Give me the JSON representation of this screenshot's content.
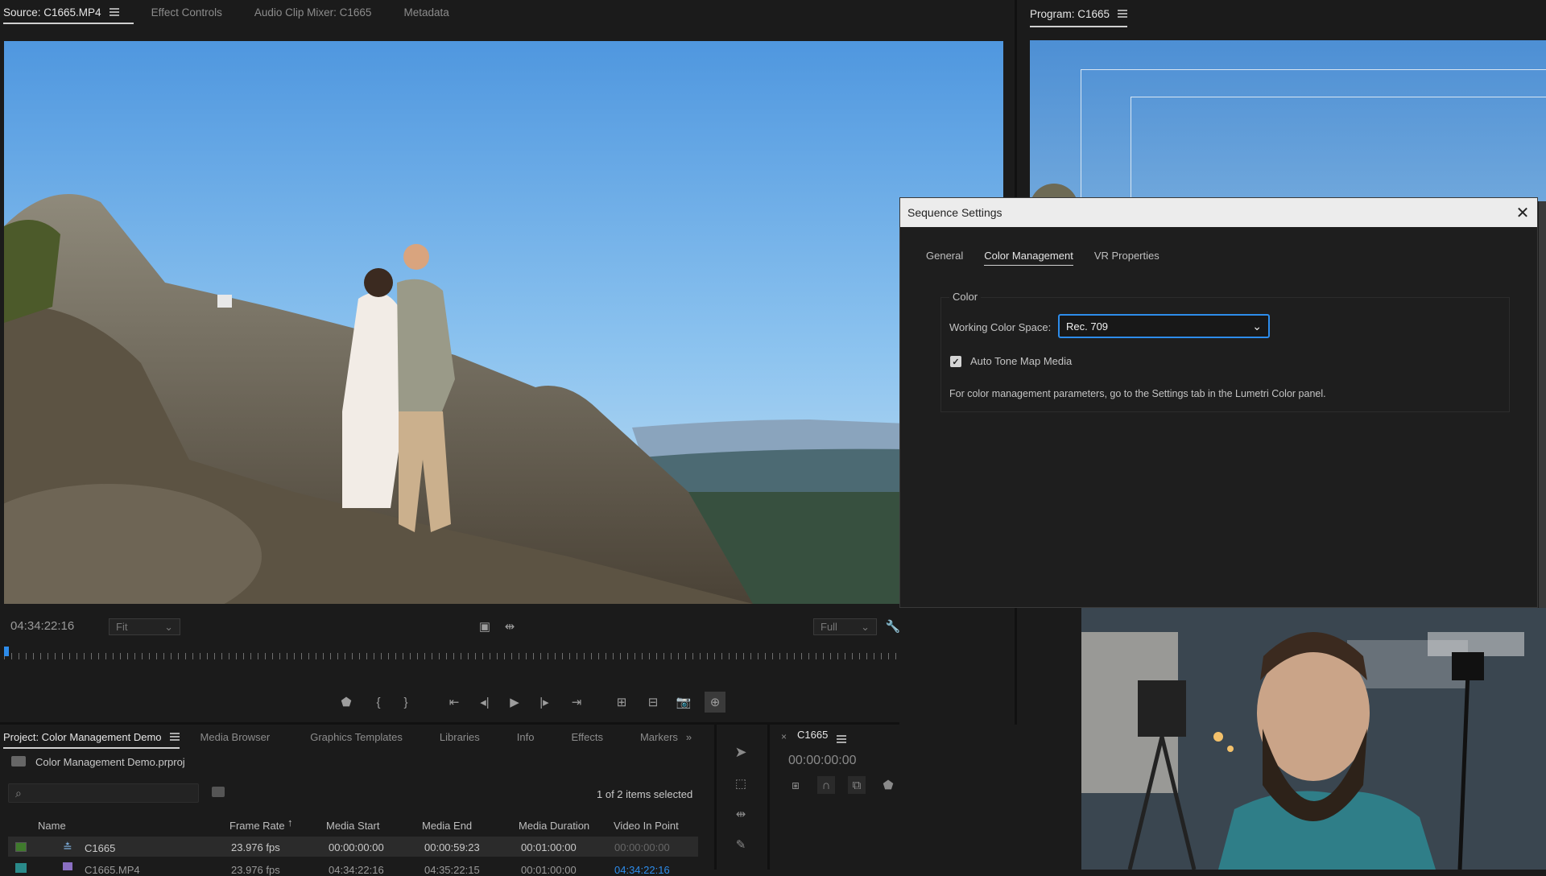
{
  "source_panel": {
    "tabs": [
      {
        "label": "Source: C1665.MP4"
      },
      {
        "label": "Effect Controls"
      },
      {
        "label": "Audio Clip Mixer: C1665"
      },
      {
        "label": "Metadata"
      }
    ],
    "timecode": "04:34:22:16",
    "zoom": "Fit",
    "resolution": "Full"
  },
  "program_panel": {
    "title": "Program: C1665"
  },
  "dialog": {
    "title": "Sequence Settings",
    "tabs": [
      {
        "label": "General"
      },
      {
        "label": "Color Management"
      },
      {
        "label": "VR Properties"
      }
    ],
    "group_label": "Color",
    "working_color_space_label": "Working Color Space:",
    "working_color_space_value": "Rec. 709",
    "auto_tone_map_label": "Auto Tone Map Media",
    "auto_tone_map_checked": true,
    "info_text": "For color management parameters, go to the Settings tab in the Lumetri Color panel."
  },
  "project_panel": {
    "tabs": [
      {
        "label": "Project: Color Management Demo"
      },
      {
        "label": "Media Browser"
      },
      {
        "label": "Graphics Templates"
      },
      {
        "label": "Libraries"
      },
      {
        "label": "Info"
      },
      {
        "label": "Effects"
      },
      {
        "label": "Markers"
      }
    ],
    "project_file": "Color Management Demo.prproj",
    "selection_status": "1 of 2 items selected",
    "columns": [
      "Name",
      "Frame Rate",
      "Media Start",
      "Media End",
      "Media Duration",
      "Video In Point"
    ],
    "rows": [
      {
        "name": "C1665",
        "frame_rate": "23.976 fps",
        "media_start": "00:00:00:00",
        "media_end": "00:00:59:23",
        "media_duration": "00:01:00:00",
        "video_in": "00:00:00:00",
        "swatch": "#3f7a2c"
      },
      {
        "name": "C1665.MP4",
        "frame_rate": "23.976 fps",
        "media_start": "04:34:22:16",
        "media_end": "04:35:22:15",
        "media_duration": "00:01:00:00",
        "video_in": "04:34:22:16",
        "swatch": "#2a8a8a"
      }
    ]
  },
  "timeline_panel": {
    "title": "C1665",
    "timecode": "00:00:00:00"
  },
  "colors": {
    "accent_blue": "#2d8ceb",
    "panel_bg": "#1b1b1b"
  }
}
